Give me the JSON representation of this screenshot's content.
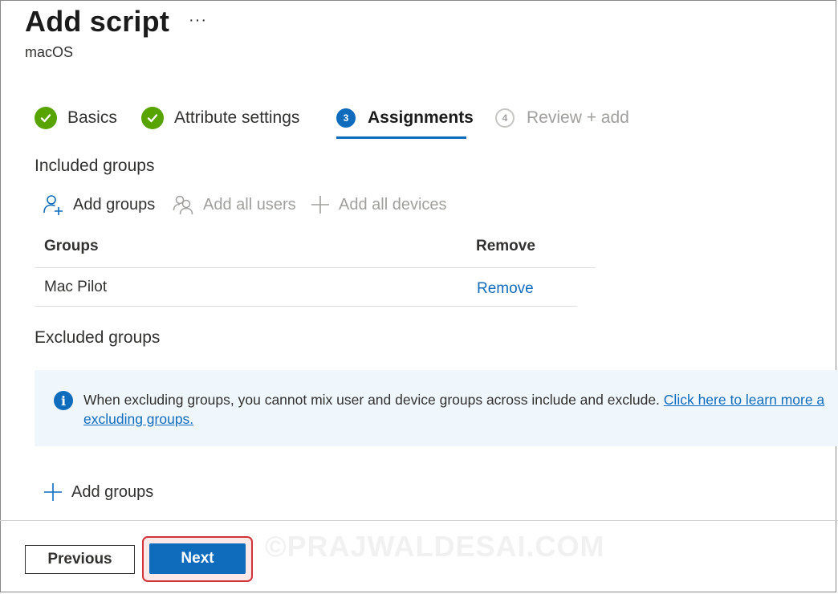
{
  "header": {
    "title": "Add script",
    "more_label": "···",
    "subtitle": "macOS"
  },
  "wizard": {
    "steps": [
      {
        "label": "Basics",
        "state": "done"
      },
      {
        "label": "Attribute settings",
        "state": "done"
      },
      {
        "number": "3",
        "label": "Assignments",
        "state": "active"
      },
      {
        "number": "4",
        "label": "Review + add",
        "state": "disabled"
      }
    ]
  },
  "included": {
    "heading": "Included groups",
    "commands": {
      "add_groups": "Add groups",
      "add_all_users": "Add all users",
      "add_all_devices": "Add all devices"
    },
    "table": {
      "headers": [
        "Groups",
        "Remove"
      ],
      "rows": [
        {
          "group": "Mac Pilot",
          "action": "Remove"
        }
      ]
    }
  },
  "excluded": {
    "heading": "Excluded groups",
    "info": {
      "text": "When excluding groups, you cannot mix user and device groups across include and exclude.",
      "link_line1": "Click here to learn more a",
      "link_line2": "excluding groups."
    },
    "add_groups": "Add groups"
  },
  "footer": {
    "previous": "Previous",
    "next": "Next"
  },
  "watermark": "©PRAJWALDESAI.COM",
  "colors": {
    "accent": "#0f6cbd",
    "success": "#57a300",
    "highlight": "#d13438"
  }
}
